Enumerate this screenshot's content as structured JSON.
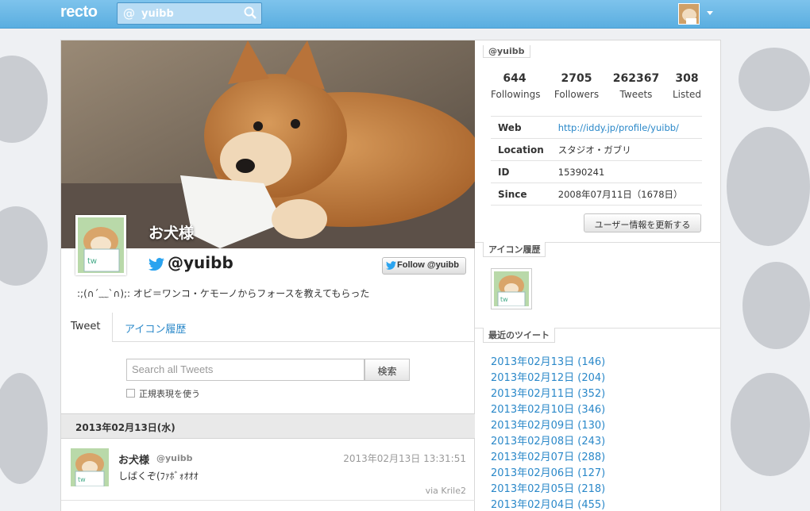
{
  "app": {
    "logo": "recto",
    "search_prefix": "@",
    "search_value": "yuibb"
  },
  "profile": {
    "display_name": "お犬様",
    "handle": "@yuibb",
    "follow_label": "Follow @yuibb",
    "bio": ":;(∩´﹏`∩);: オビ＝ワンコ・ケモーノからフォースを教えてもらった"
  },
  "tabs": [
    {
      "label": "Tweet"
    },
    {
      "label": "アイコン履歴"
    }
  ],
  "tweet_search": {
    "placeholder": "Search all Tweets",
    "button": "検索",
    "regex_label": "正規表現を使う"
  },
  "timeline": {
    "date_header": "2013年02月13日(水)",
    "tweets": [
      {
        "name": "お犬様",
        "handle": "@yuibb",
        "time": "2013年02月13日 13:31:51",
        "text": "しばくぞ(ﾌｧﾎﾞｫｵｵｵ",
        "via": "via Krile2"
      }
    ]
  },
  "sidebar": {
    "user_label": "@yuibb",
    "stats": [
      {
        "num": "644",
        "label": "Followings"
      },
      {
        "num": "2705",
        "label": "Followers"
      },
      {
        "num": "262367",
        "label": "Tweets"
      },
      {
        "num": "308",
        "label": "Listed"
      }
    ],
    "info": [
      {
        "key": "Web",
        "value": "http://iddy.jp/profile/yuibb/"
      },
      {
        "key": "Location",
        "value": "スタジオ・ガブリ"
      },
      {
        "key": "ID",
        "value": "15390241"
      },
      {
        "key": "Since",
        "value": "2008年07月11日（1678日）"
      }
    ],
    "update_button": "ユーザー情報を更新する",
    "icon_history_label": "アイコン履歴",
    "recent_label": "最近のツイート",
    "recent": [
      "2013年02月13日 (146)",
      "2013年02月12日 (204)",
      "2013年02月11日 (352)",
      "2013年02月10日 (346)",
      "2013年02月09日 (130)",
      "2013年02月08日 (243)",
      "2013年02月07日 (288)",
      "2013年02月06日 (127)",
      "2013年02月05日 (218)",
      "2013年02月04日 (455)"
    ]
  },
  "colors": {
    "topbar": "#6bb9e7",
    "link": "#2a88c9"
  }
}
